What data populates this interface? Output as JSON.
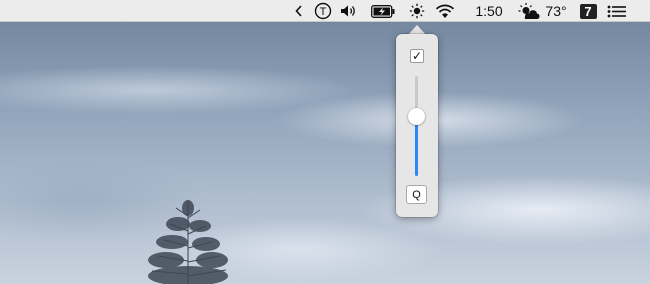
{
  "menubar": {
    "items": [
      {
        "name": "chevron-left-icon"
      },
      {
        "name": "timing-app-icon",
        "glyph": "T"
      },
      {
        "name": "volume-icon"
      },
      {
        "name": "battery-charging-icon"
      },
      {
        "name": "brightness-sun-icon"
      },
      {
        "name": "wifi-icon"
      }
    ],
    "clock": "1:50",
    "weather_icon": "partly-cloudy-icon",
    "temperature": "73°",
    "calendar_day": "7",
    "notification_icon": "list-icon"
  },
  "popover": {
    "checkbox_mark": "✓",
    "checkbox_checked": true,
    "slider_level_fraction": 0.6,
    "slider_accent": "#2f86f6",
    "key_label": "Q"
  }
}
